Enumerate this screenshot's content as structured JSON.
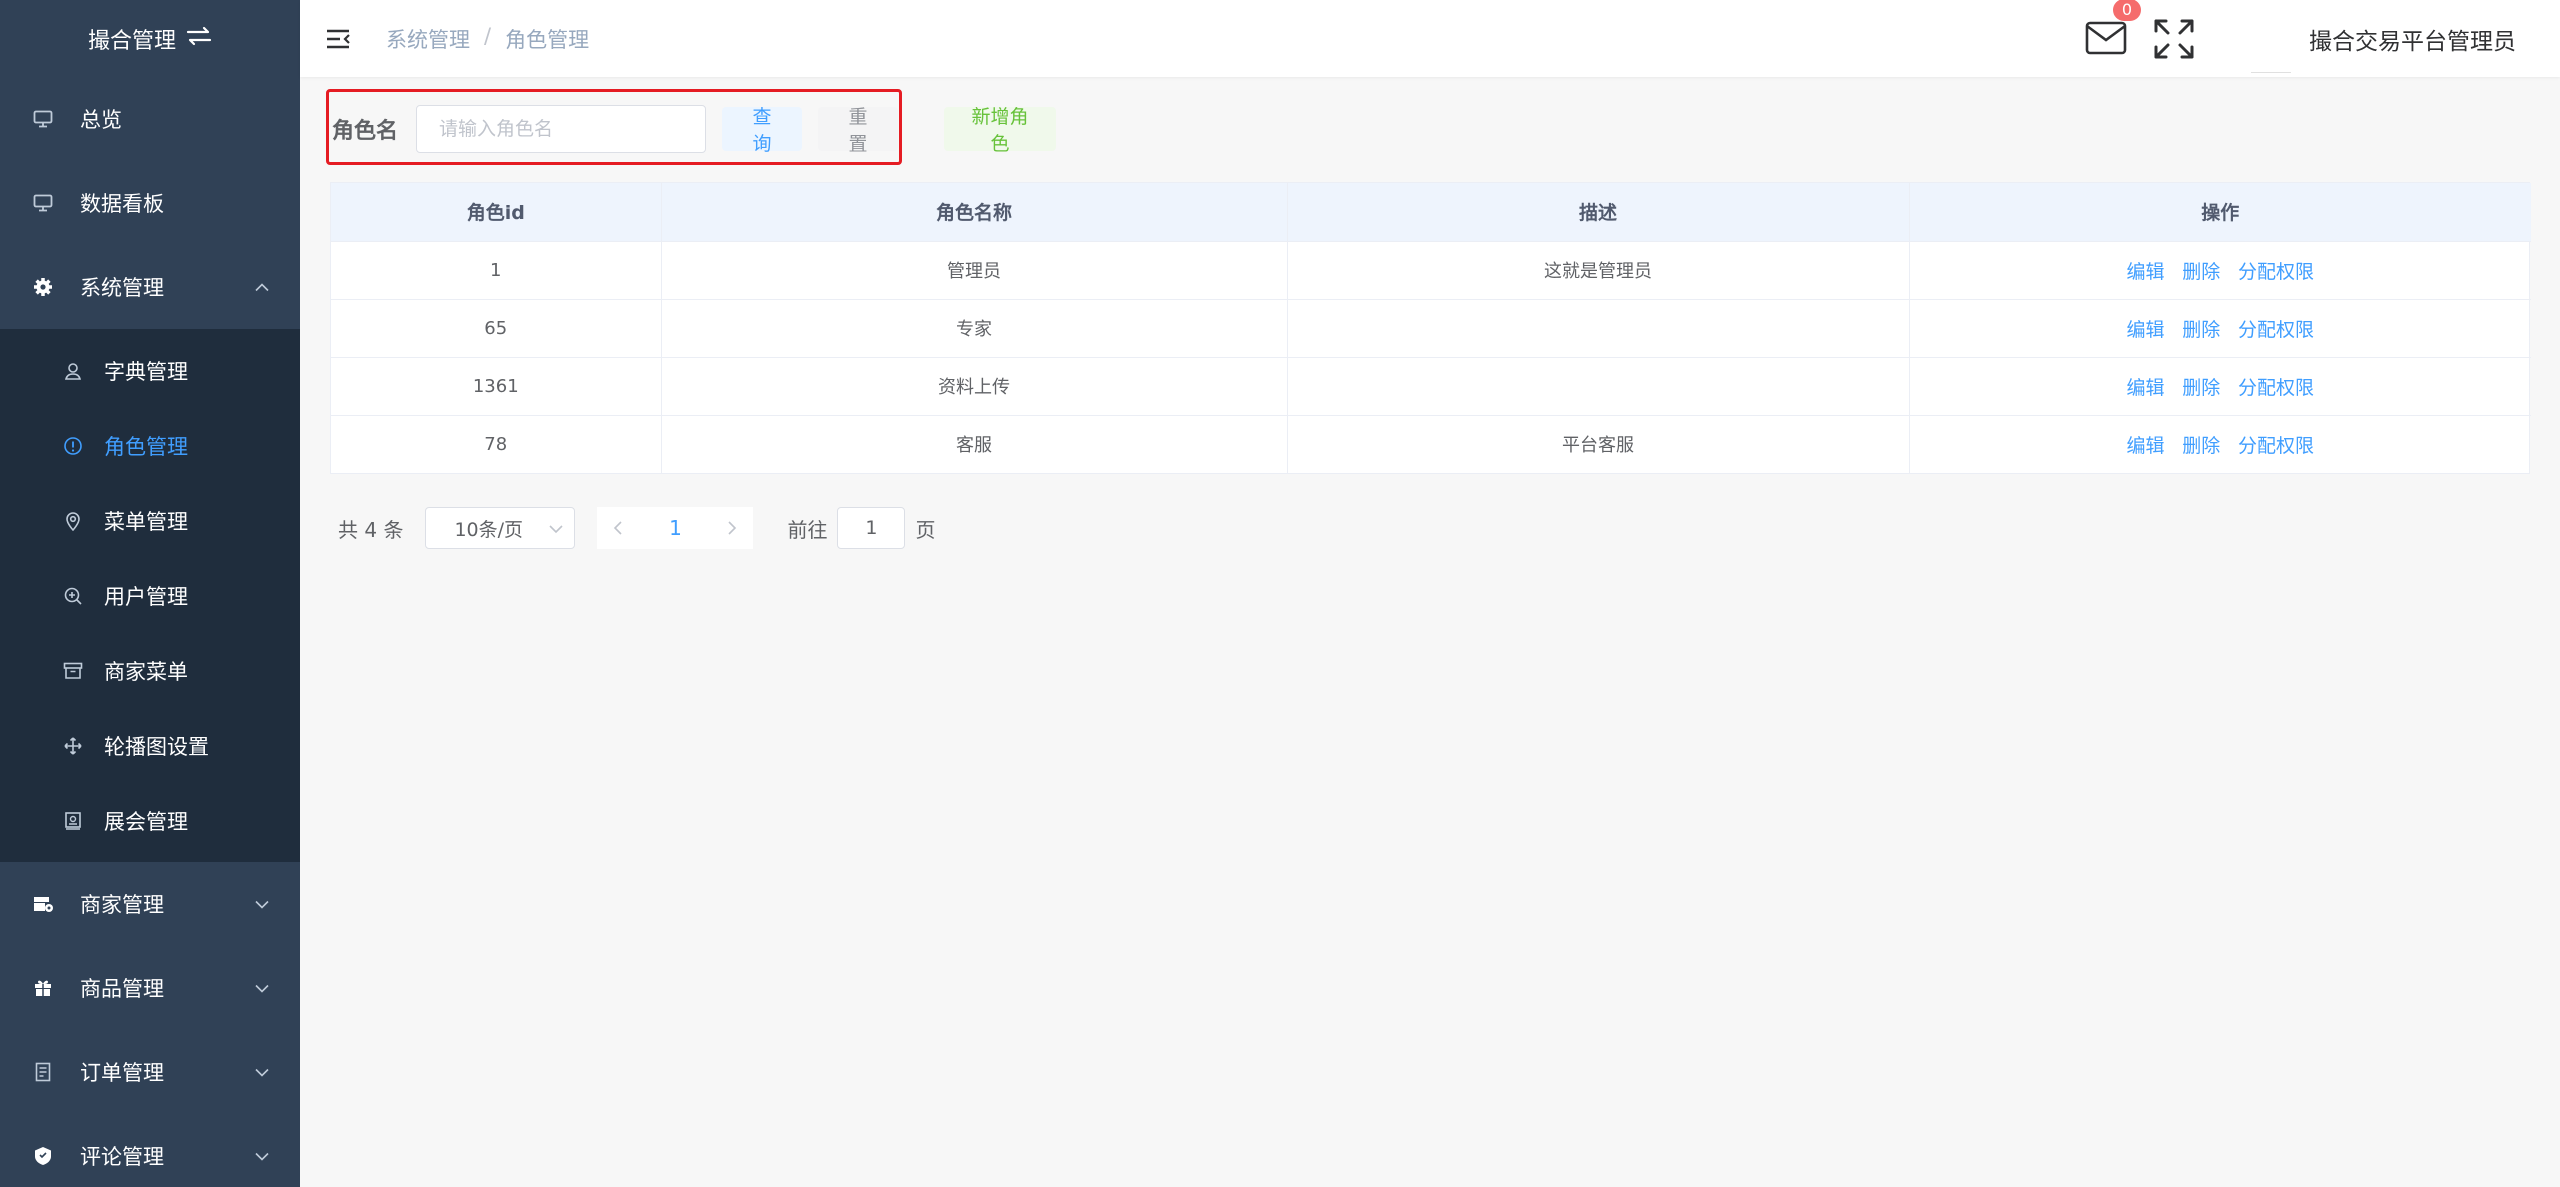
{
  "sidebar": {
    "logo_text": "撮合管理",
    "logo_icon": "swap-icon",
    "items_top": [
      {
        "label": "总览",
        "icon": "monitor-icon"
      },
      {
        "label": "数据看板",
        "icon": "monitor-icon"
      },
      {
        "label": "系统管理",
        "icon": "gear-icon",
        "expanded": true
      }
    ],
    "sub_items": [
      {
        "label": "字典管理",
        "icon": "user-icon"
      },
      {
        "label": "角色管理",
        "icon": "info-circle-icon",
        "active": true
      },
      {
        "label": "菜单管理",
        "icon": "location-icon"
      },
      {
        "label": "用户管理",
        "icon": "zoom-in-icon"
      },
      {
        "label": "商家菜单",
        "icon": "box-icon"
      },
      {
        "label": "轮播图设置",
        "icon": "move-icon"
      },
      {
        "label": "展会管理",
        "icon": "picture-icon"
      }
    ],
    "items_bottom": [
      {
        "label": "商家管理",
        "icon": "shop-icon"
      },
      {
        "label": "商品管理",
        "icon": "gift-icon"
      },
      {
        "label": "订单管理",
        "icon": "document-icon"
      },
      {
        "label": "评论管理",
        "icon": "comment-icon"
      }
    ]
  },
  "header": {
    "breadcrumb": [
      "系统管理",
      "角色管理"
    ],
    "breadcrumb_sep": "/",
    "badge_count": "0",
    "username": "撮合交易平台管理员"
  },
  "toolbar": {
    "label": "角色名",
    "placeholder": "请输入角色名",
    "query_label": "查询",
    "reset_label": "重置",
    "add_label": "新增角色"
  },
  "table": {
    "columns": [
      "角色id",
      "角色名称",
      "描述",
      "操作"
    ],
    "rows": [
      {
        "id": "1",
        "name": "管理员",
        "desc": "这就是管理员"
      },
      {
        "id": "65",
        "name": "专家",
        "desc": ""
      },
      {
        "id": "1361",
        "name": "资料上传",
        "desc": ""
      },
      {
        "id": "78",
        "name": "客服",
        "desc": "平台客服"
      }
    ],
    "actions": {
      "edit": "编辑",
      "delete": "删除",
      "assign": "分配权限"
    }
  },
  "pagination": {
    "total": "共 4 条",
    "page_size": "10条/页",
    "current": "1",
    "goto_prefix": "前往",
    "goto_value": "1",
    "goto_suffix": "页"
  },
  "colors": {
    "sidebar_bg": "#304156",
    "submenu_bg": "#1f2d3d",
    "active": "#409eff",
    "highlight": "#e51c23"
  }
}
